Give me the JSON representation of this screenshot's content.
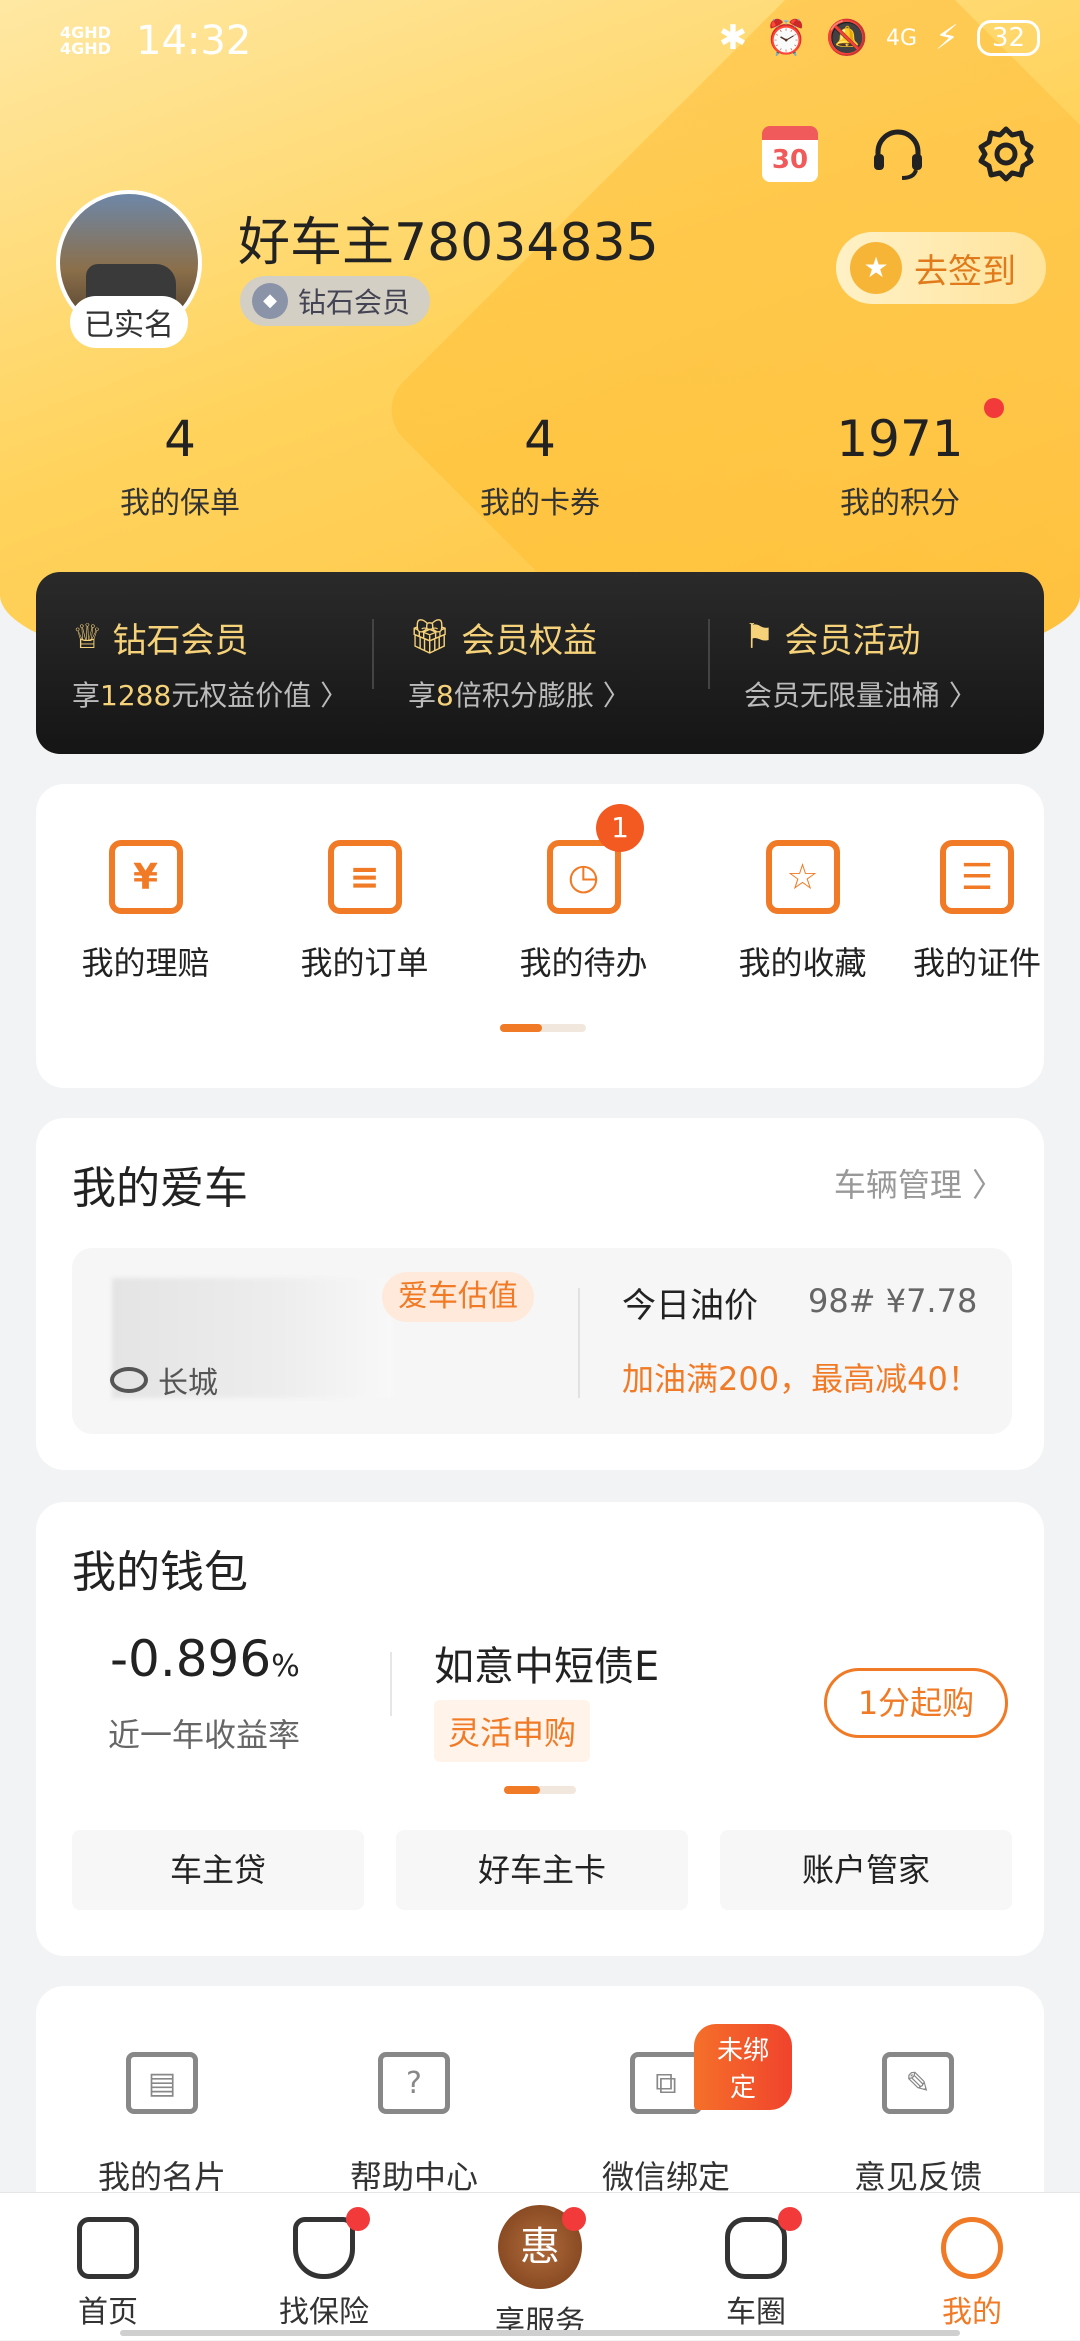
{
  "status": {
    "network": "4GHD 4GHD",
    "time": "14:32",
    "battery": "32",
    "icons": [
      "bluetooth-icon",
      "alarm-icon",
      "mute-icon",
      "4g-icon",
      "charging-icon"
    ]
  },
  "header": {
    "calendar_day": "30",
    "username": "好车主78034835",
    "verified_label": "已实名",
    "member_level": "钻石会员",
    "sign_button": "去签到"
  },
  "stats": [
    {
      "value": "4",
      "label": "我的保单"
    },
    {
      "value": "4",
      "label": "我的卡券"
    },
    {
      "value": "1971",
      "label": "我的积分"
    }
  ],
  "vip": [
    {
      "title": "钻石会员",
      "sub_prefix": "享",
      "sub_highlight": "1288",
      "sub_suffix": "元权益价值 〉"
    },
    {
      "title": "会员权益",
      "sub_prefix": "享",
      "sub_highlight": "8",
      "sub_suffix": "倍积分膨胀 〉"
    },
    {
      "title": "会员活动",
      "sub_prefix": "",
      "sub_highlight": "",
      "sub_suffix": "会员无限量油桶 〉"
    }
  ],
  "quick": [
    {
      "label": "我的理赔",
      "icon": "¥"
    },
    {
      "label": "我的订单",
      "icon": "≡"
    },
    {
      "label": "我的待办",
      "icon": "◷",
      "badge": "1"
    },
    {
      "label": "我的收藏",
      "icon": "☆"
    },
    {
      "label": "我的证件",
      "icon": "☰"
    }
  ],
  "car": {
    "title": "我的爱车",
    "manage": "车辆管理 〉",
    "eval_tag": "爱车估值",
    "brand": "长城",
    "oil_title": "今日油价",
    "oil_price": "98#  ¥7.78",
    "oil_promo": "加油满200，最高减40！"
  },
  "wallet": {
    "title": "我的钱包",
    "rate": "-0.896",
    "rate_unit": "%",
    "rate_label": "近一年收益率",
    "fund_name": "如意中短债E",
    "fund_tag": "灵活申购",
    "buy_button": "1分起购",
    "buttons": [
      "车主贷",
      "好车主卡",
      "账户管家"
    ]
  },
  "tools": [
    {
      "label": "我的名片",
      "icon": "▤"
    },
    {
      "label": "帮助中心",
      "icon": "?"
    },
    {
      "label": "微信绑定",
      "icon": "⧉",
      "badge": "未绑定"
    },
    {
      "label": "意见反馈",
      "icon": "✎"
    }
  ],
  "tabs": [
    {
      "label": "首页"
    },
    {
      "label": "找保险"
    },
    {
      "label": "享服务",
      "center": "惠"
    },
    {
      "label": "车圈"
    },
    {
      "label": "我的"
    }
  ]
}
